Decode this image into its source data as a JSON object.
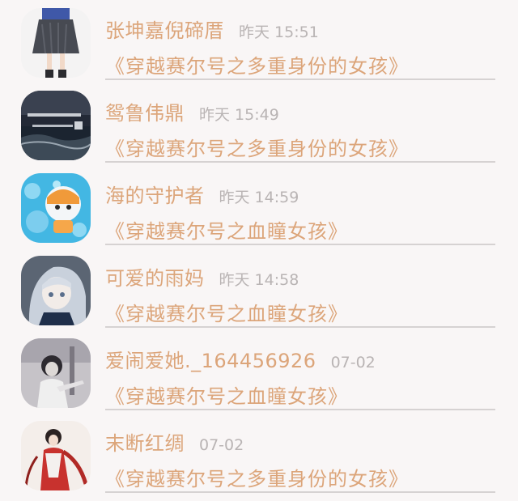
{
  "comments": [
    {
      "username": "张坤嘉倪碲厝",
      "time": "昨天 15:51",
      "book_title": "《穿越赛尔号之多重身份的女孩》",
      "avatar_icon": "avatar-girl-skirt"
    },
    {
      "username": "鸳鲁伟鼎",
      "time": "昨天 15:49",
      "book_title": "《穿越赛尔号之多重身份的女孩》",
      "avatar_icon": "avatar-dark-sea"
    },
    {
      "username": "海的守护者",
      "time": "昨天 14:59",
      "book_title": "《穿越赛尔号之血瞳女孩》",
      "avatar_icon": "avatar-cartoon-bubbles"
    },
    {
      "username": "可爱的雨妈",
      "time": "昨天 14:58",
      "book_title": "《穿越赛尔号之血瞳女孩》",
      "avatar_icon": "avatar-anime-girl"
    },
    {
      "username": "爱闹爱她._164456926",
      "time": "07-02",
      "book_title": "《穿越赛尔号之血瞳女孩》",
      "avatar_icon": "avatar-bw-girl"
    },
    {
      "username": "末断红绸",
      "time": "07-02",
      "book_title": "《穿越赛尔号之多重身份的女孩》",
      "avatar_icon": "avatar-red-costume"
    }
  ],
  "colors": {
    "background": "#f9f6f6",
    "accent": "#dca57a",
    "time": "#b9b4b4",
    "divider": "#d6d2d2"
  }
}
